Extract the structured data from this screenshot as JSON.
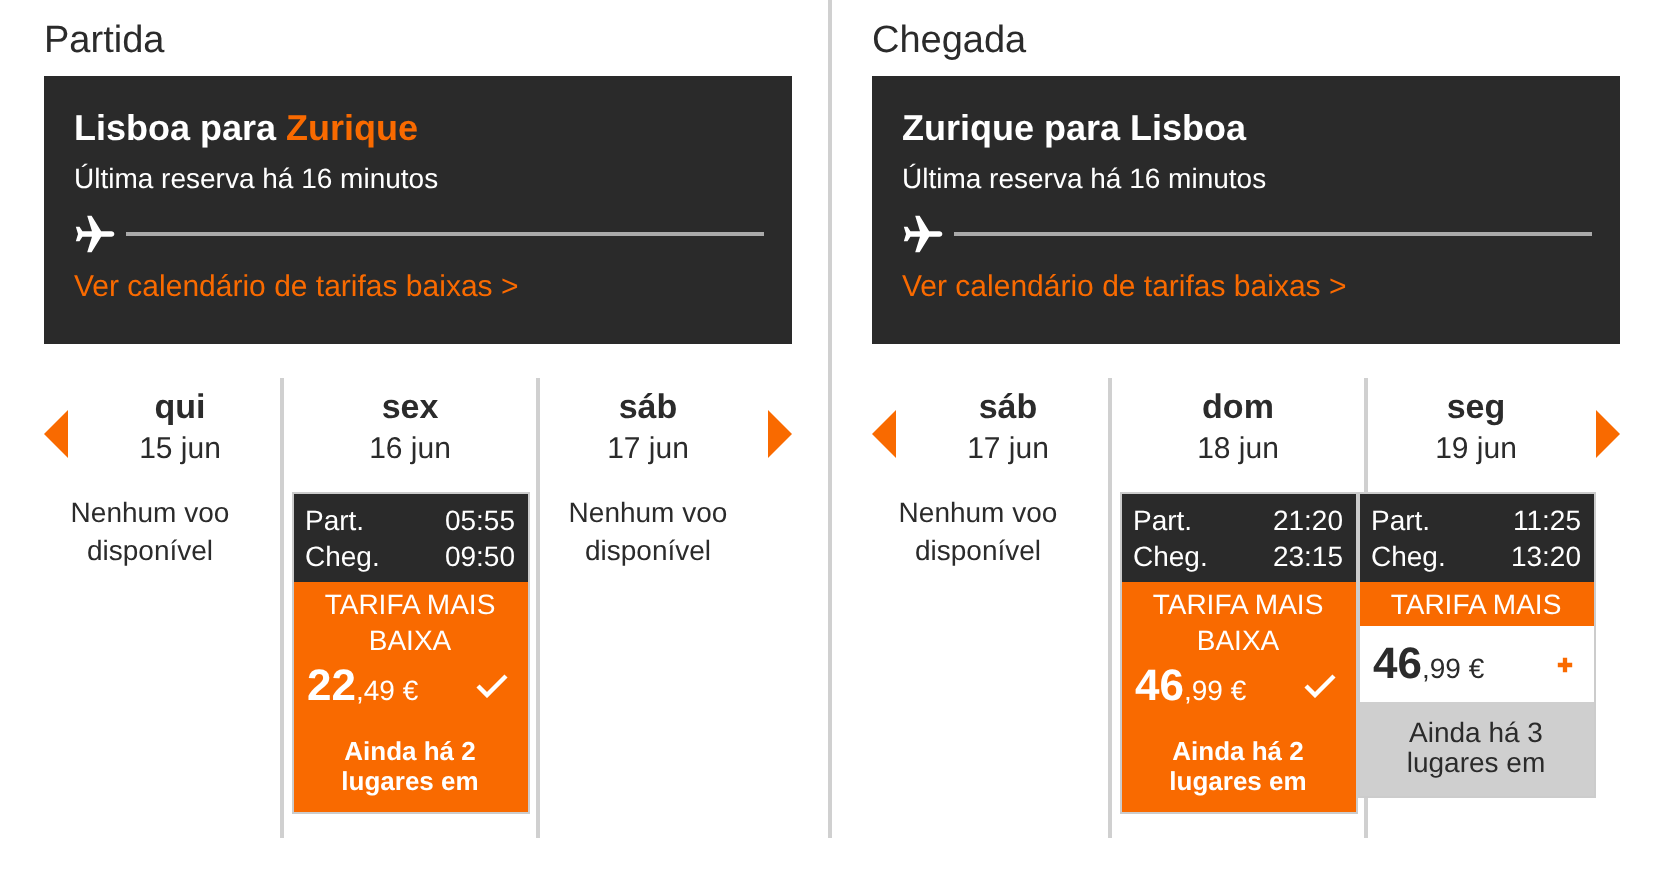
{
  "sections": [
    {
      "heading": "Partida",
      "route_parts": [
        {
          "text": "Lisboa para ",
          "highlight": false
        },
        {
          "text": "Zurique",
          "highlight": true
        }
      ],
      "last_booking": "Última reserva há 16 minutos",
      "calendar_link": "Ver calendário de tarifas baixas >",
      "days": [
        {
          "kind": "none",
          "weekday": "qui",
          "date": "15 jun",
          "message": "Nenhum voo disponível"
        },
        {
          "kind": "flight",
          "weekday": "sex",
          "date": "16 jun",
          "dep_label": "Part.",
          "dep_time": "05:55",
          "arr_label": "Cheg.",
          "arr_time": "09:50",
          "fare_label": "TARIFA MAIS BAIXA",
          "price_whole": "22",
          "price_rest": ",49 €",
          "selected": true,
          "seats_note": "Ainda há 2 lugares em"
        },
        {
          "kind": "none",
          "weekday": "sáb",
          "date": "17 jun",
          "message": "Nenhum voo disponível"
        }
      ]
    },
    {
      "heading": "Chegada",
      "route_parts": [
        {
          "text": "Zurique para Lisboa",
          "highlight": false
        }
      ],
      "last_booking": "Última reserva há 16 minutos",
      "calendar_link": "Ver calendário de tarifas baixas >",
      "days": [
        {
          "kind": "none",
          "weekday": "sáb",
          "date": "17 jun",
          "message": "Nenhum voo disponível"
        },
        {
          "kind": "flight",
          "weekday": "dom",
          "date": "18 jun",
          "dep_label": "Part.",
          "dep_time": "21:20",
          "arr_label": "Cheg.",
          "arr_time": "23:15",
          "fare_label": "TARIFA MAIS BAIXA",
          "price_whole": "46",
          "price_rest": ",99 €",
          "selected": true,
          "seats_note": "Ainda há 2 lugares em"
        },
        {
          "kind": "flight",
          "weekday": "seg",
          "date": "19 jun",
          "dep_label": "Part.",
          "dep_time": "11:25",
          "arr_label": "Cheg.",
          "arr_time": "13:20",
          "fare_label": "TARIFA MAIS",
          "price_whole": "46",
          "price_rest": ",99 €",
          "selected": false,
          "seats_note": "Ainda há 3 lugares em"
        }
      ]
    }
  ]
}
